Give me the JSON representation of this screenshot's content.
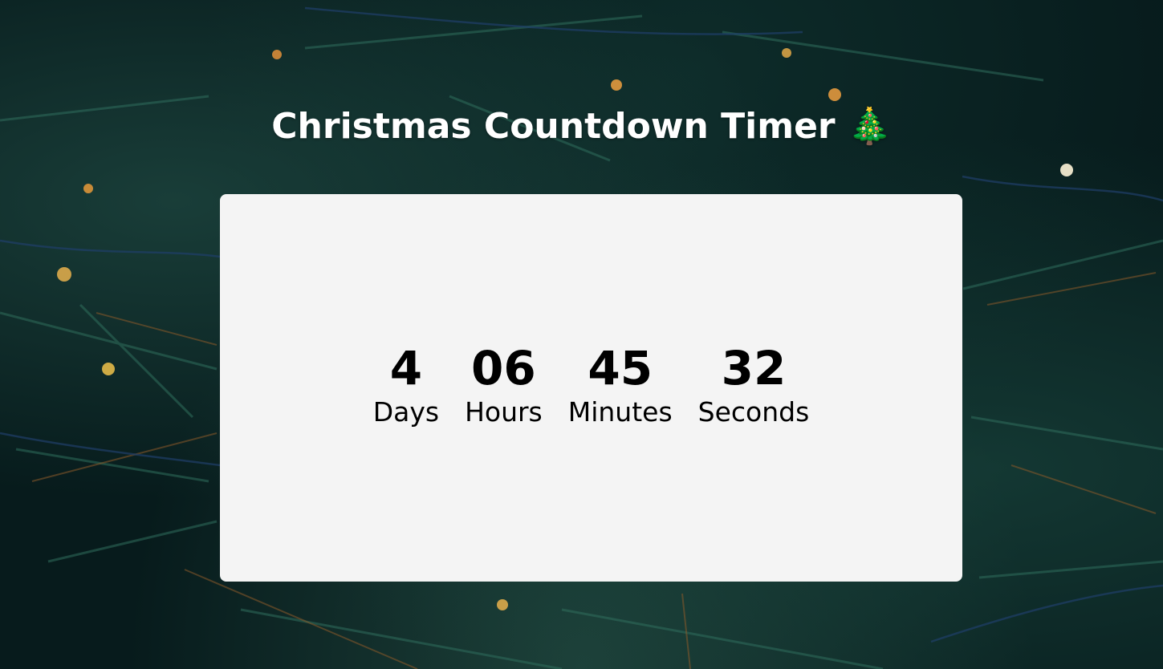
{
  "header": {
    "title": "Christmas Countdown Timer",
    "title_emoji": "🎄"
  },
  "countdown": {
    "units": [
      {
        "value": "4",
        "label": "Days"
      },
      {
        "value": "06",
        "label": "Hours"
      },
      {
        "value": "45",
        "label": "Minutes"
      },
      {
        "value": "32",
        "label": "Seconds"
      }
    ]
  },
  "colors": {
    "background": "#071b1c",
    "card": "#f4f4f4",
    "title_text": "#ffffff",
    "timer_text": "#000000"
  }
}
